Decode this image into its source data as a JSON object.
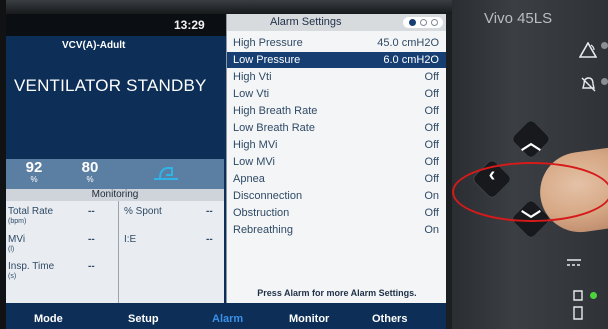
{
  "device": {
    "brand": "Vivo 45LS"
  },
  "status_bar": {
    "time": "13:29"
  },
  "ventilation": {
    "mode": "VCV(A)-Adult",
    "state": "VENTILATOR STANDBY"
  },
  "vitals": [
    {
      "value": "92",
      "unit": "%"
    },
    {
      "value": "80",
      "unit": "%"
    }
  ],
  "monitoring": {
    "title": "Monitoring",
    "items": [
      {
        "label": "Total Rate",
        "unit": "(bpm)",
        "value": "--"
      },
      {
        "label": "MVi",
        "unit": "(l)",
        "value": "--"
      },
      {
        "label": "Insp. Time",
        "unit": "(s)",
        "value": "--"
      },
      {
        "label": "% Spont",
        "value": "--"
      },
      {
        "label": "I:E",
        "value": "--"
      }
    ]
  },
  "alarm_settings": {
    "title": "Alarm Settings",
    "rows": [
      {
        "name": "High Pressure",
        "value": "45.0 cmH2O"
      },
      {
        "name": "Low Pressure",
        "value": "6.0 cmH2O",
        "selected": true
      },
      {
        "name": "High Vti",
        "value": "Off"
      },
      {
        "name": "Low Vti",
        "value": "Off"
      },
      {
        "name": "High Breath Rate",
        "value": "Off"
      },
      {
        "name": "Low Breath Rate",
        "value": "Off"
      },
      {
        "name": "High MVi",
        "value": "Off"
      },
      {
        "name": "Low MVi",
        "value": "Off"
      },
      {
        "name": "Apnea",
        "value": "Off"
      },
      {
        "name": "Disconnection",
        "value": "On"
      },
      {
        "name": "Obstruction",
        "value": "Off"
      },
      {
        "name": "Rebreathing",
        "value": "On"
      }
    ],
    "footer": "Press Alarm for more Alarm Settings."
  },
  "menu": {
    "items": [
      "Mode",
      "Setup",
      "Alarm",
      "Monitor",
      "Others"
    ],
    "active": "Alarm"
  },
  "colors": {
    "screen_bg": "#0d2f57",
    "selected_row": "#163e73",
    "active_menu": "#3a8fe6",
    "highlight_ring": "#d61a1a",
    "led_green": "#4cd43c"
  },
  "icons": {
    "nav_up": "^",
    "nav_left": "<",
    "nav_down": "v",
    "alarm_silence": "bell-slash-icon",
    "alarm": "triangle-alarm-icon"
  }
}
